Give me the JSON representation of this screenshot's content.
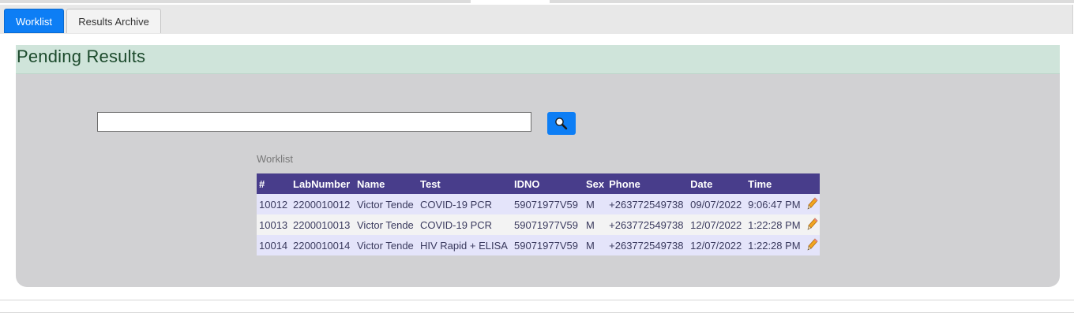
{
  "tabs": [
    {
      "label": "Worklist",
      "active": true
    },
    {
      "label": "Results Archive",
      "active": false
    }
  ],
  "panel": {
    "title": "Pending Results"
  },
  "search": {
    "value": "",
    "placeholder": "",
    "button_icon": "magnifier-icon"
  },
  "worklist": {
    "caption": "Worklist",
    "columns": [
      "#",
      "LabNumber",
      "Name",
      "Test",
      "IDNO",
      "Sex",
      "Phone",
      "Date",
      "Time"
    ],
    "rows": [
      {
        "num": "10012",
        "lab_number": "2200010012",
        "name": "Victor Tende",
        "test": "COVID-19 PCR",
        "idno": "59071977V59",
        "sex": "M",
        "phone": "+263772549738",
        "date": "09/07/2022",
        "time": "9:06:47 PM"
      },
      {
        "num": "10013",
        "lab_number": "2200010013",
        "name": "Victor Tende",
        "test": "COVID-19 PCR",
        "idno": "59071977V59",
        "sex": "M",
        "phone": "+263772549738",
        "date": "12/07/2022",
        "time": "1:22:28 PM"
      },
      {
        "num": "10014",
        "lab_number": "2200010014",
        "name": "Victor Tende",
        "test": "HIV Rapid + ELISA",
        "idno": "59071977V59",
        "sex": "M",
        "phone": "+263772549738",
        "date": "12/07/2022",
        "time": "1:22:28 PM"
      }
    ],
    "edit_icon": "pencil-icon"
  },
  "colors": {
    "accent": "#0d7ef5",
    "table_header": "#483d8b",
    "panel_header": "#cfe4da",
    "panel_body": "#d1d1d3"
  }
}
